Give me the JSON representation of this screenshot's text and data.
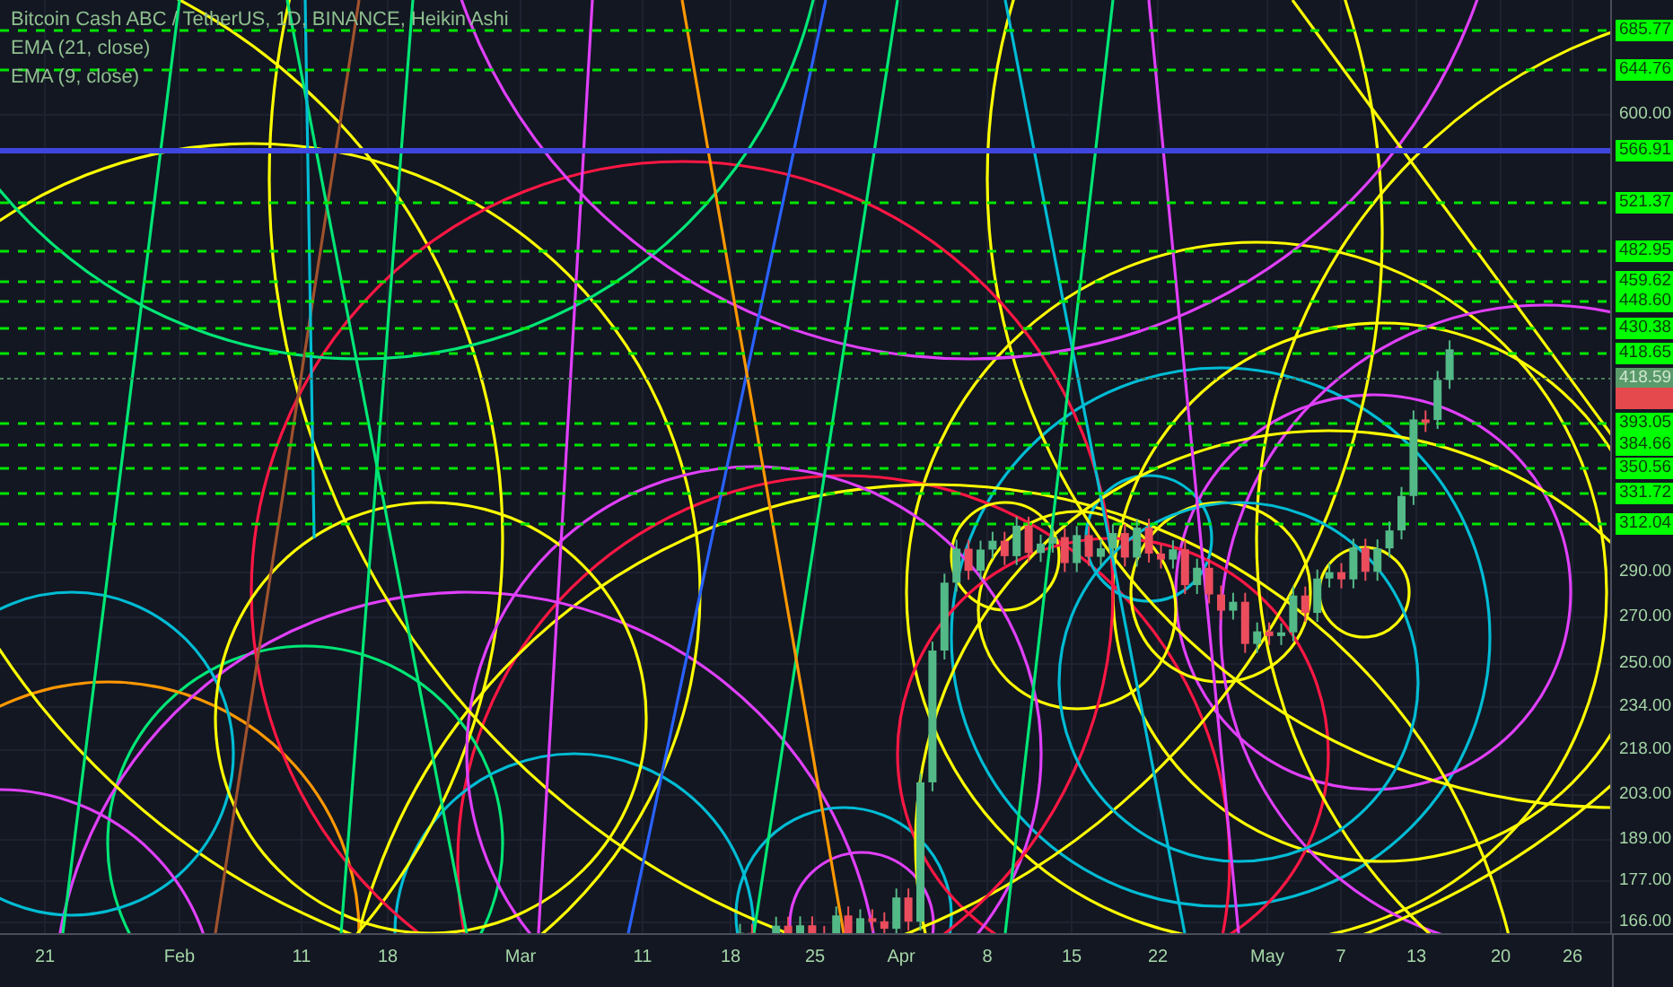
{
  "legend": [
    "Bitcoin Cash ABC / TetherUS, 1D, BINANCE, Heikin Ashi",
    "EMA (21, close)",
    "EMA (9, close)"
  ],
  "price_axis": [
    {
      "label": "685.77",
      "kind": "level"
    },
    {
      "label": "644.76",
      "kind": "level"
    },
    {
      "label": "600.00",
      "kind": "tick"
    },
    {
      "label": "566.91",
      "kind": "line"
    },
    {
      "label": "521.37",
      "kind": "level"
    },
    {
      "label": "482.95",
      "kind": "level"
    },
    {
      "label": "459.62",
      "kind": "level"
    },
    {
      "label": "448.60",
      "kind": "level"
    },
    {
      "label": "430.38",
      "kind": "level"
    },
    {
      "label": "418.65",
      "kind": "level"
    },
    {
      "label": "418.59",
      "kind": "last"
    },
    {
      "kind": "current"
    },
    {
      "label": "393.05",
      "kind": "level"
    },
    {
      "label": "384.66",
      "kind": "level"
    },
    {
      "label": "350.56",
      "kind": "level"
    },
    {
      "label": "331.72",
      "kind": "level"
    },
    {
      "label": "312.04",
      "kind": "level"
    },
    {
      "label": "290.00",
      "kind": "tick"
    },
    {
      "label": "270.00",
      "kind": "tick"
    },
    {
      "label": "250.00",
      "kind": "tick"
    },
    {
      "label": "234.00",
      "kind": "tick"
    },
    {
      "label": "218.00",
      "kind": "tick"
    },
    {
      "label": "203.00",
      "kind": "tick"
    },
    {
      "label": "189.00",
      "kind": "tick"
    },
    {
      "label": "177.00",
      "kind": "tick"
    },
    {
      "label": "166.00",
      "kind": "tick"
    }
  ],
  "time_axis": [
    "21",
    "Feb",
    "11",
    "18",
    "Mar",
    "11",
    "18",
    "25",
    "Apr",
    "8",
    "15",
    "22",
    "May",
    "7",
    "13",
    "20",
    "26"
  ]
}
